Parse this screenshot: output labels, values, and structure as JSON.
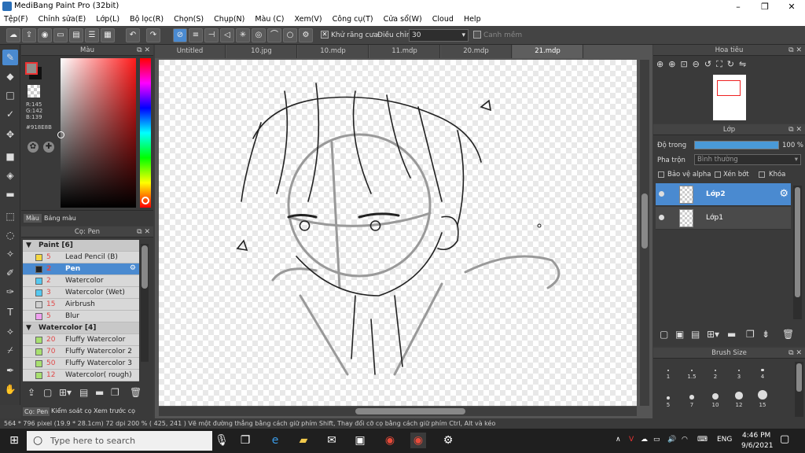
{
  "window": {
    "title": "MediBang Paint Pro (32bit)"
  },
  "menu": [
    "Tệp(F)",
    "Chỉnh sửa(E)",
    "Lớp(L)",
    "Bộ lọc(R)",
    "Chọn(S)",
    "Chụp(N)",
    "Màu (C)",
    "Xem(V)",
    "Công cụ(T)",
    "Cửa sổ(W)",
    "Cloud",
    "Help"
  ],
  "toolbar": {
    "antialias_label": "Khử răng cưa",
    "adjust_label": "Điều chỉnh",
    "adjust_value": "30",
    "edge_label": "Canh mềm"
  },
  "color_panel": {
    "title": "Màu",
    "r": "R:145",
    "g": "G:142",
    "b": "B:139",
    "hex": "#918E8B",
    "fg_color": "#918E8B",
    "tabs": [
      "Màu",
      "Bảng màu"
    ]
  },
  "brush_panel": {
    "title": "Cọ: Pen",
    "rows": [
      {
        "type": "group",
        "label": "Paint [6]"
      },
      {
        "type": "item",
        "size": "5",
        "name": "Lead Pencil (B)",
        "color": "#f5d842"
      },
      {
        "type": "item",
        "size": "2",
        "name": "Pen",
        "color": "#222222",
        "selected": true
      },
      {
        "type": "item",
        "size": "2",
        "name": "Watercolor",
        "color": "#55c8f0"
      },
      {
        "type": "item",
        "size": "3",
        "name": "Watercolor (Wet)",
        "color": "#55c8f0"
      },
      {
        "type": "item",
        "size": "15",
        "name": "Airbrush",
        "color": "#d0d0d0"
      },
      {
        "type": "item",
        "size": "5",
        "name": "Blur",
        "color": "#f0a0f0"
      },
      {
        "type": "group",
        "label": "Watercolor [4]"
      },
      {
        "type": "item",
        "size": "20",
        "name": "Fluffy Watercolor",
        "color": "#a8e070"
      },
      {
        "type": "item",
        "size": "70",
        "name": "Fluffy Watercolor 2",
        "color": "#a8e070"
      },
      {
        "type": "item",
        "size": "50",
        "name": "Fluffy Watercolor 3",
        "color": "#a8e070"
      },
      {
        "type": "item",
        "size": "12",
        "name": "Watercolor( rough)",
        "color": "#a8e070"
      }
    ],
    "bottom_tabs": [
      "Cọ: Pen",
      "Kiểm soát cọ",
      "Xem trước cọ"
    ]
  },
  "doc_tabs": [
    "Untitled",
    "10.jpg",
    "10.mdp",
    "11.mdp",
    "20.mdp",
    "21.mdp"
  ],
  "active_doc_tab": 5,
  "navigator": {
    "title": "Hoa tiêu"
  },
  "layer_panel": {
    "title": "Lớp",
    "opacity_label": "Độ trong",
    "opacity_value": "100 %",
    "blend_label": "Pha trộn",
    "blend_value": "Bình thường",
    "protect_alpha": "Bảo vệ alpha",
    "clipping": "Xén bớt",
    "lock": "Khóa",
    "layers": [
      {
        "name": "Lớp2",
        "selected": true
      },
      {
        "name": "Lớp1",
        "selected": false
      }
    ]
  },
  "brush_size": {
    "title": "Brush Size",
    "sizes": [
      "1",
      "1.5",
      "2",
      "3",
      "4",
      "5",
      "7",
      "10",
      "12",
      "15"
    ]
  },
  "status": "564 * 796 pixel  (19.9 * 28.1cm)  72 dpi  200 %  ( 425, 241 )  Vẽ một đường thẳng bằng cách giữ phím Shift, Thay đổi cỡ cọ bằng cách giữ phím Ctrl, Alt và kéo",
  "taskbar": {
    "search_placeholder": "Type here to search",
    "lang": "ENG",
    "time": "4:46 PM",
    "date": "9/6/2021"
  }
}
